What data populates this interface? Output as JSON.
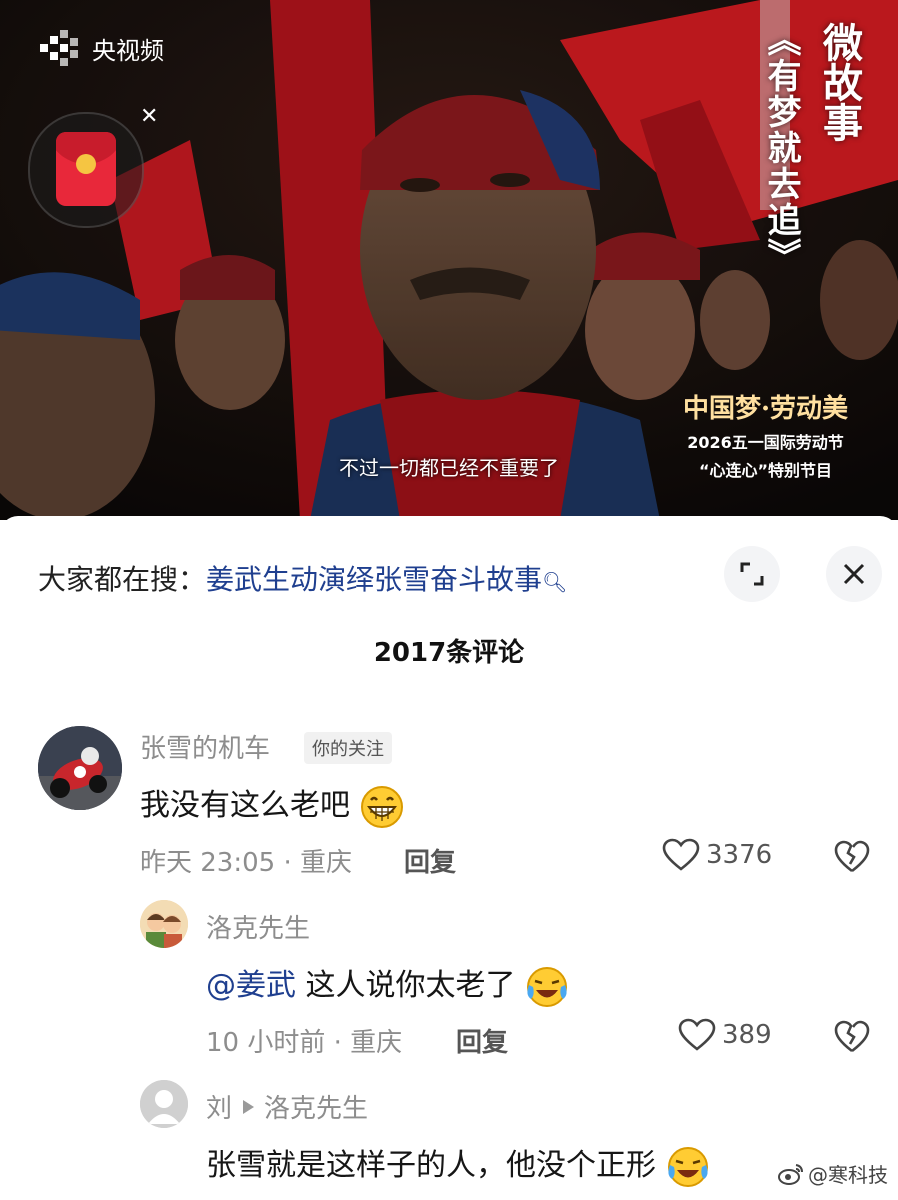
{
  "video": {
    "brand": "央视频",
    "title_prefix": "微故事",
    "title_main": "《有梦就去追》",
    "event_line1": "中国梦·劳动美",
    "event_line2": "2026五一国际劳动节",
    "event_line3": "“心连心”特别节目",
    "subtitle": "不过一切都已经不重要了"
  },
  "search": {
    "prefix": "大家都在搜：",
    "keyword": "姜武生动演绎张雪奋斗故事"
  },
  "comment_count": "2017条评论",
  "comments": [
    {
      "username": "张雪的机车",
      "tag": "你的关注",
      "text": "我没有这么老吧",
      "time_location": "昨天 23:05 · 重庆",
      "reply_label": "回复",
      "likes": "3376"
    },
    {
      "username": "洛克先生",
      "mention": "@姜武",
      "text": " 这人说你太老了",
      "time_location": "10 小时前 · 重庆",
      "reply_label": "回复",
      "likes": "389"
    },
    {
      "username": "刘",
      "reply_to": "洛克先生",
      "text": "张雪就是这样子的人，他没个正形"
    }
  ],
  "watermark": "@寒科技",
  "icons": [
    "play-logo-icon",
    "red-packet-icon",
    "close-icon",
    "search-icon",
    "expand-icon",
    "heart-icon",
    "broken-heart-icon",
    "grin-emoji-icon",
    "crying-laugh-emoji-icon",
    "default-avatar-icon",
    "weibo-icon"
  ]
}
